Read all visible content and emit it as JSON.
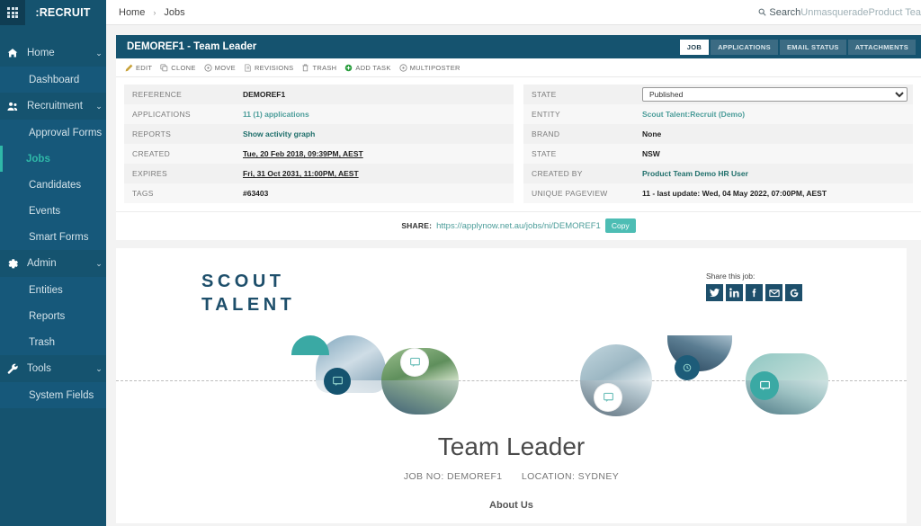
{
  "sidebar": {
    "waffle_icon": "grid-icon",
    "logo": ":RECRUIT",
    "groups": [
      {
        "label": "Home",
        "icon": "home-icon",
        "caret": "⌄",
        "items": [
          {
            "label": "Dashboard",
            "active": false
          }
        ]
      },
      {
        "label": "Recruitment",
        "icon": "people-icon",
        "caret": "⌄",
        "items": [
          {
            "label": "Approval Forms",
            "active": false
          },
          {
            "label": "Jobs",
            "active": true
          },
          {
            "label": "Candidates",
            "active": false
          },
          {
            "label": "Events",
            "active": false
          },
          {
            "label": "Smart Forms",
            "active": false
          }
        ]
      },
      {
        "label": "Admin",
        "icon": "gear-icon",
        "caret": "⌄",
        "items": [
          {
            "label": "Entities",
            "active": false
          },
          {
            "label": "Reports",
            "active": false
          },
          {
            "label": "Trash",
            "active": false
          }
        ]
      },
      {
        "label": "Tools",
        "icon": "wrench-icon",
        "caret": "⌄",
        "items": [
          {
            "label": "System Fields",
            "active": false
          }
        ]
      }
    ]
  },
  "topbar": {
    "breadcrumb": [
      "Home",
      "Jobs"
    ],
    "separator": "›",
    "search_icon": "search-icon",
    "search_label": "Search",
    "unmasquerade_label": "Unmasquerade",
    "user_label": "Product Tea"
  },
  "panel": {
    "title": "DEMOREF1 - Team Leader",
    "tabs": [
      {
        "label": "JOB",
        "active": true
      },
      {
        "label": "APPLICATIONS",
        "active": false
      },
      {
        "label": "EMAIL STATUS",
        "active": false
      },
      {
        "label": "ATTACHMENTS",
        "active": false
      }
    ],
    "actions": [
      {
        "label": "EDIT",
        "icon": "pencil-icon"
      },
      {
        "label": "CLONE",
        "icon": "clone-icon"
      },
      {
        "label": "MOVE",
        "icon": "move-icon"
      },
      {
        "label": "REVISIONS",
        "icon": "revisions-icon"
      },
      {
        "label": "TRASH",
        "icon": "trash-icon"
      },
      {
        "label": "ADD TASK",
        "icon": "add-task-icon"
      },
      {
        "label": "MULTIPOSTER",
        "icon": "multiposter-icon"
      }
    ]
  },
  "fields_left": [
    {
      "key": "REFERENCE",
      "value": "DEMOREF1",
      "style": "bold"
    },
    {
      "key": "APPLICATIONS",
      "value": "11 (1) applications",
      "style": "link"
    },
    {
      "key": "REPORTS",
      "value": "Show activity graph",
      "style": "link-dark"
    },
    {
      "key": "CREATED",
      "value": "Tue, 20 Feb 2018, 09:39PM, AEST",
      "style": "underline"
    },
    {
      "key": "EXPIRES",
      "value": "Fri, 31 Oct 2031, 11:00PM, AEST",
      "style": "underline"
    },
    {
      "key": "TAGS",
      "value": "#63403",
      "style": "bold"
    }
  ],
  "fields_right": [
    {
      "key": "STATE",
      "value": "Published",
      "style": "select",
      "options": [
        "Published"
      ]
    },
    {
      "key": "ENTITY",
      "value": "Scout Talent:Recruit (Demo)",
      "style": "link"
    },
    {
      "key": "BRAND",
      "value": "None",
      "style": "bold"
    },
    {
      "key": "STATE",
      "value": "NSW",
      "style": "bold"
    },
    {
      "key": "CREATED BY",
      "value": "Product Team Demo HR User",
      "style": "link-dark"
    },
    {
      "key": "UNIQUE PAGEVIEW",
      "value": "11 - last update: Wed, 04 May 2022, 07:00PM, AEST",
      "style": "bold"
    }
  ],
  "share": {
    "label": "SHARE:",
    "url": "https://applynow.net.au/jobs/ni/DEMOREF1",
    "copy_label": "Copy"
  },
  "preview": {
    "logo_line1": "SCOUT",
    "logo_line2": "TALENT",
    "share_title": "Share this job:",
    "social": [
      {
        "name": "twitter-icon",
        "glyph": "twitter"
      },
      {
        "name": "linkedin-icon",
        "glyph": "in"
      },
      {
        "name": "facebook-icon",
        "glyph": "f"
      },
      {
        "name": "email-icon",
        "glyph": "mail"
      },
      {
        "name": "google-icon",
        "glyph": "G"
      }
    ],
    "job_title": "Team Leader",
    "job_no_label": "JOB NO: DEMOREF1",
    "location_label": "LOCATION: SYDNEY",
    "section_heading": "About Us"
  },
  "colors": {
    "sidebar": "#15536f",
    "sidebar_sub": "#16587a",
    "accent_teal": "#2fb8a8",
    "link_teal": "#4c9d9a",
    "brand_navy": "#1e4f6b",
    "copy_button": "#4dbdb4"
  }
}
